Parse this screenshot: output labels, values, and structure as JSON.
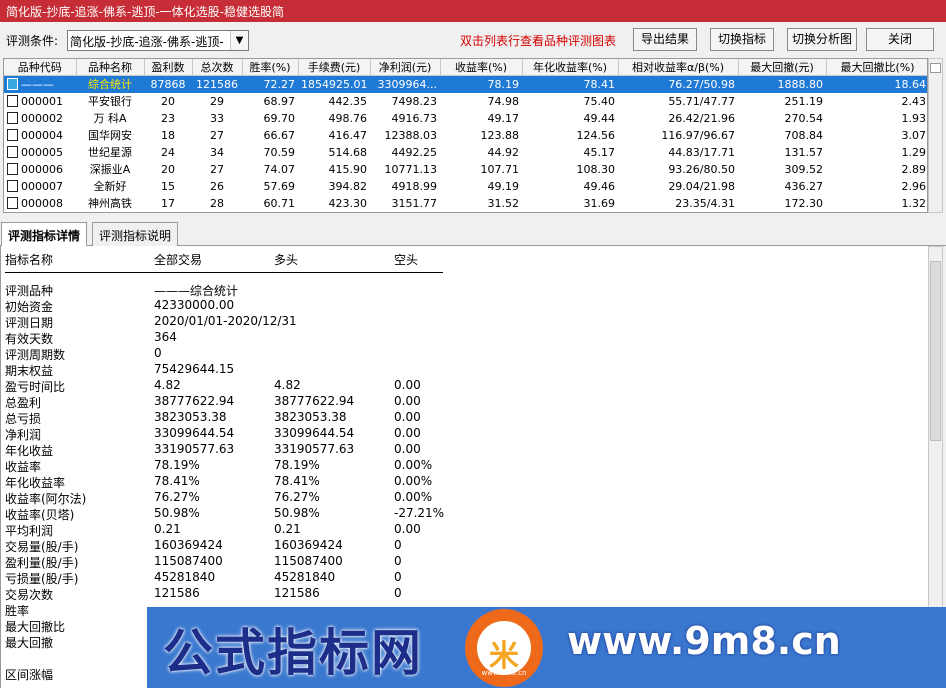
{
  "window": {
    "title": "简化版-抄底-追涨-佛系-逃顶-一体化选股-稳健选股简"
  },
  "toolbar": {
    "cond_label": "评测条件:",
    "cond_value": "简化版-抄底-追涨-佛系-逃顶-",
    "hint": "双击列表行查看品种评测图表",
    "export": "导出结果",
    "switch_indicator": "切换指标",
    "switch_chart": "切换分析图",
    "close": "关闭"
  },
  "grid": {
    "headers": [
      "品种代码",
      "品种名称",
      "盈利数",
      "总次数",
      "胜率(%)",
      "手续费(元)",
      "净利润(元)",
      "收益率(%)",
      "年化收益率(%)",
      "相对收益率α/β(%)",
      "最大回撤(元)",
      "最大回撤比(%)"
    ],
    "rows": [
      [
        "———",
        "综合统计",
        "87868",
        "121586",
        "72.27",
        "1854925.01",
        "3309964...",
        "78.19",
        "78.41",
        "76.27/50.98",
        "1888.80",
        "18.64"
      ],
      [
        "000001",
        "平安银行",
        "20",
        "29",
        "68.97",
        "442.35",
        "7498.23",
        "74.98",
        "75.40",
        "55.71/47.77",
        "251.19",
        "2.43"
      ],
      [
        "000002",
        "万 科A",
        "23",
        "33",
        "69.70",
        "498.76",
        "4916.73",
        "49.17",
        "49.44",
        "26.42/21.96",
        "270.54",
        "1.93"
      ],
      [
        "000004",
        "国华网安",
        "18",
        "27",
        "66.67",
        "416.47",
        "12388.03",
        "123.88",
        "124.56",
        "116.97/96.67",
        "708.84",
        "3.07"
      ],
      [
        "000005",
        "世纪星源",
        "24",
        "34",
        "70.59",
        "514.68",
        "4492.25",
        "44.92",
        "45.17",
        "44.83/17.71",
        "131.57",
        "1.29"
      ],
      [
        "000006",
        "深振业A",
        "20",
        "27",
        "74.07",
        "415.90",
        "10771.13",
        "107.71",
        "108.30",
        "93.26/80.50",
        "309.52",
        "2.89"
      ],
      [
        "000007",
        "全新好",
        "15",
        "26",
        "57.69",
        "394.82",
        "4918.99",
        "49.19",
        "49.46",
        "29.04/21.98",
        "436.27",
        "2.96"
      ],
      [
        "000008",
        "神州高铁",
        "17",
        "28",
        "60.71",
        "423.30",
        "3151.77",
        "31.52",
        "31.69",
        "23.35/4.31",
        "172.30",
        "1.32"
      ]
    ]
  },
  "tabs": [
    "评测指标详情",
    "评测指标说明"
  ],
  "detail": {
    "headers": [
      "指标名称",
      "全部交易",
      "多头",
      "空头"
    ],
    "rows": [
      [
        "评测品种",
        "———综合统计",
        "",
        ""
      ],
      [
        "初始资金",
        "42330000.00",
        "",
        ""
      ],
      [
        "评测日期",
        "2020/01/01-2020/12/31",
        "",
        ""
      ],
      [
        "有效天数",
        "364",
        "",
        ""
      ],
      [
        "评测周期数",
        "0",
        "",
        ""
      ],
      [
        "期末权益",
        "75429644.15",
        "",
        ""
      ],
      [
        "盈亏时间比",
        "4.82",
        "4.82",
        "0.00"
      ],
      [
        "总盈利",
        "38777622.94",
        "38777622.94",
        "0.00"
      ],
      [
        "总亏损",
        "3823053.38",
        "3823053.38",
        "0.00"
      ],
      [
        "净利润",
        "33099644.54",
        "33099644.54",
        "0.00"
      ],
      [
        "年化收益",
        "33190577.63",
        "33190577.63",
        "0.00"
      ],
      [
        "收益率",
        "78.19%",
        "78.19%",
        "0.00%"
      ],
      [
        "年化收益率",
        "78.41%",
        "78.41%",
        "0.00%"
      ],
      [
        "收益率(阿尔法)",
        "76.27%",
        "76.27%",
        "0.00%"
      ],
      [
        "收益率(贝塔)",
        "50.98%",
        "50.98%",
        "-27.21%"
      ],
      [
        "平均利润",
        "0.21",
        "0.21",
        "0.00"
      ],
      [
        "交易量(股/手)",
        "160369424",
        "160369424",
        "0"
      ],
      [
        "盈利量(股/手)",
        "115087400",
        "115087400",
        "0"
      ],
      [
        "亏损量(股/手)",
        "45281840",
        "45281840",
        "0"
      ],
      [
        "交易次数",
        "121586",
        "121586",
        "0"
      ],
      [
        "胜率",
        "",
        "",
        ""
      ],
      [
        "最大回撤比",
        "",
        "",
        ""
      ],
      [
        "最大回撤",
        "",
        "",
        ""
      ],
      [
        "",
        "",
        "",
        ""
      ],
      [
        "区间涨幅",
        "",
        "",
        ""
      ]
    ]
  },
  "watermark": {
    "cn": "公式指标网",
    "url": "www.9m8.cn",
    "logo": "米",
    "logo_small": "www.9m8.cn"
  },
  "colors": {
    "title_bg": "#c62d36",
    "selection": "#1f7ad6",
    "hint": "#d40000"
  }
}
